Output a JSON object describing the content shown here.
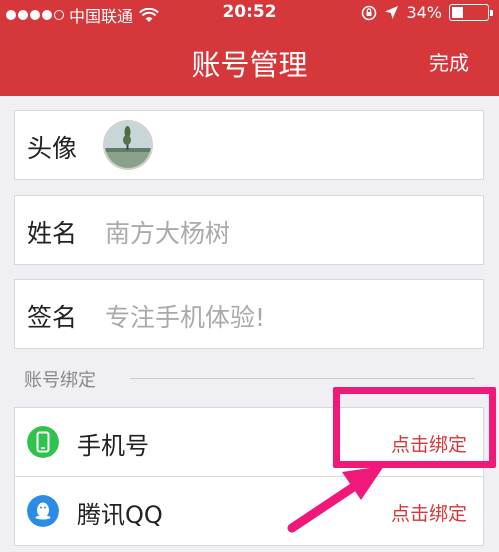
{
  "colors": {
    "primary_red": "#d5373a",
    "highlight_pink": "#f0197a",
    "phone_green": "#2fc24c",
    "qq_blue": "#2a8ce5"
  },
  "status_bar": {
    "carrier": "中国联通",
    "time": "20:52",
    "battery": "34%",
    "battery_level": 0.34
  },
  "header": {
    "title": "账号管理",
    "done_label": "完成"
  },
  "profile": {
    "avatar_label": "头像",
    "name_label": "姓名",
    "name_value": "南方大杨树",
    "signature_label": "签名",
    "signature_value": "专注手机体验!"
  },
  "binding": {
    "section_title": "账号绑定",
    "items": [
      {
        "label": "手机号",
        "action": "点击绑定",
        "icon": "phone-icon"
      },
      {
        "label": "腾讯QQ",
        "action": "点击绑定",
        "icon": "qq-penguin-icon"
      }
    ]
  }
}
